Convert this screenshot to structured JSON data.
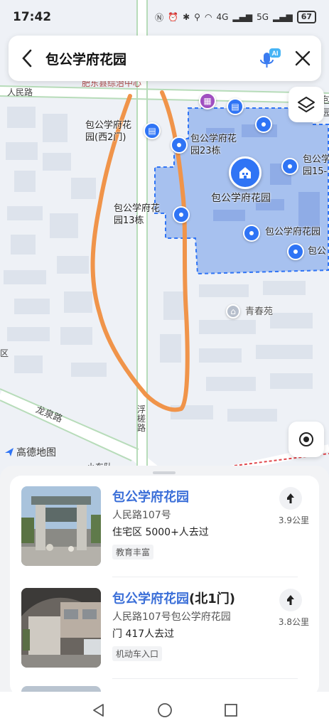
{
  "status": {
    "time": "17:42",
    "battery": "67",
    "signal_4g": "4G",
    "signal_5g": "5G"
  },
  "search": {
    "query": "包公学府花园",
    "ai_badge": "AI"
  },
  "map": {
    "labels": {
      "renmin_road": "人民路",
      "top_partial": "肥东县综治中心",
      "west_gate": "包公学府花\n园(西2门)",
      "bldg23": "包公学府花\n园23栋",
      "bldg13": "包公学府花\n园13栋",
      "main": "包公学府花园",
      "east_partial": "包公学\n园15-",
      "east_partial2": "包公学府花园",
      "east_partial3": "包公",
      "qingchun": "青春苑",
      "longquan_road": "龙泉路",
      "fuchu_road": "浮\n槎\n路",
      "left_partial": "区",
      "bottom_partial": "小东队",
      "right_edge1": "包",
      "right_edge2": "园"
    },
    "logo": "高德地图",
    "accent": "#2f74f5",
    "annotation_color": "#f0944a"
  },
  "results": [
    {
      "title": "包公学府花园",
      "title_suffix": "",
      "address": "人民路107号",
      "info": "住宅区 5000+人去过",
      "tag": "教育丰富",
      "distance": "3.9公里"
    },
    {
      "title": "包公学府花园",
      "title_suffix": "(北1门)",
      "address": "人民路107号包公学府花园",
      "info": "门 417人去过",
      "tag": "机动车入口",
      "distance": "3.8公里"
    }
  ]
}
